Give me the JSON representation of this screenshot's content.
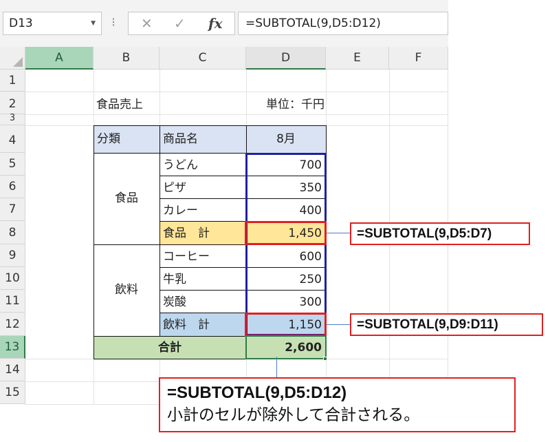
{
  "formula_bar": {
    "name_box": "D13",
    "cancel_icon": "✕",
    "enter_icon": "✓",
    "fx_label": "fx",
    "formula": "=SUBTOTAL(9,D5:D12)"
  },
  "columns": [
    "A",
    "B",
    "C",
    "D",
    "E",
    "F"
  ],
  "rows": [
    "1",
    "2",
    "3",
    "4",
    "5",
    "6",
    "7",
    "8",
    "9",
    "10",
    "11",
    "12",
    "13",
    "14",
    "15"
  ],
  "sheet": {
    "title": "食品売上",
    "unit": "単位：千円",
    "header": {
      "category": "分類",
      "product": "商品名",
      "month": "8月"
    },
    "groups": [
      {
        "name": "食品",
        "items": [
          {
            "name": "うどん",
            "value": "700"
          },
          {
            "name": "ピザ",
            "value": "350"
          },
          {
            "name": "カレー",
            "value": "400"
          }
        ],
        "subtotal_label": "食品　計",
        "subtotal_value": "1,450"
      },
      {
        "name": "飲料",
        "items": [
          {
            "name": "コーヒー",
            "value": "600"
          },
          {
            "name": "牛乳",
            "value": "250"
          },
          {
            "name": "炭酸",
            "value": "300"
          }
        ],
        "subtotal_label": "飲料　計",
        "subtotal_value": "1,150"
      }
    ],
    "total_label": "合計",
    "total_value": "2,600"
  },
  "callouts": {
    "food_subtotal": "=SUBTOTAL(9,D5:D7)",
    "drink_subtotal": "=SUBTOTAL(9,D9:D11)",
    "total_formula": "=SUBTOTAL(9,D5:D12)",
    "total_note": "小計のセルが除外して合計される。"
  },
  "colors": {
    "header_fill": "#dae3f3",
    "food_subtotal_fill": "#ffe699",
    "drink_subtotal_fill": "#bdd7ee",
    "total_fill": "#c6e0b4",
    "selection_green": "#2f7a48",
    "range_blue": "#2020a0",
    "highlight_red": "#e02020"
  }
}
